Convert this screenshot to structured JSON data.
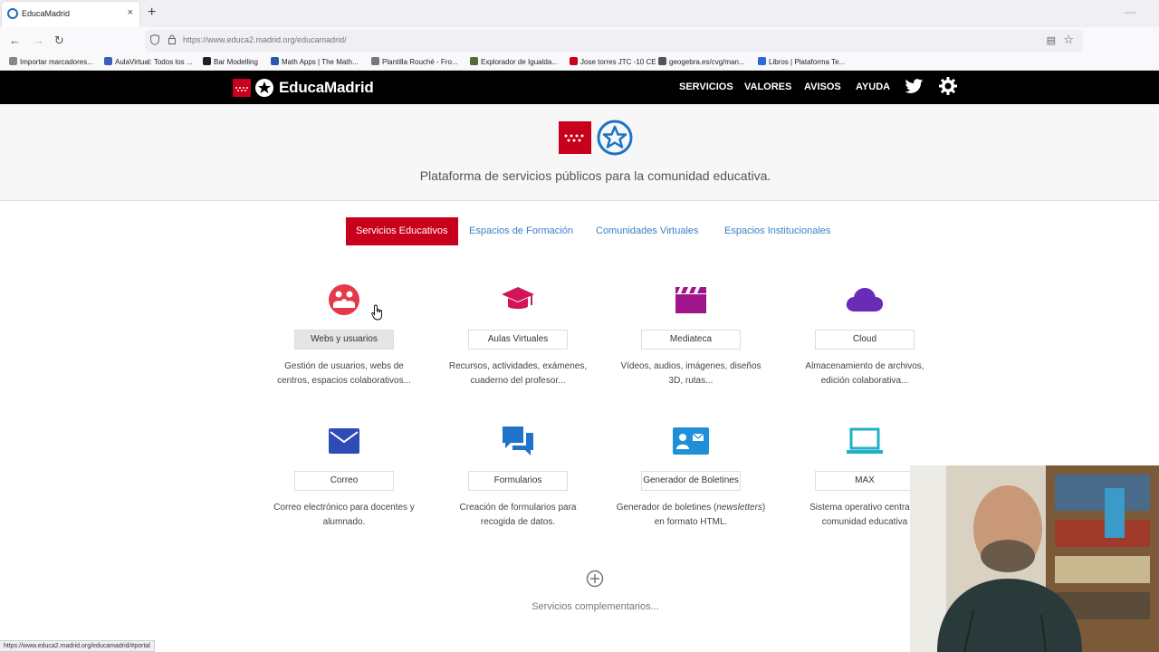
{
  "browser": {
    "tab_title": "EducaMadrid",
    "tab_close": "×",
    "new_tab": "+",
    "minimize": "—",
    "url": "https://www.educa2.madrid.org/educamadrid/",
    "bookmarks": [
      {
        "label": "Importar marcadores...",
        "color": "#888888"
      },
      {
        "label": "AulaVirtual: Todos los ...",
        "color": "#3a5fc0"
      },
      {
        "label": "Bar Modelling",
        "color": "#222222"
      },
      {
        "label": "Math Apps | The Math...",
        "color": "#2b5aa8"
      },
      {
        "label": "Plantilla Rouché - Fro...",
        "color": "#777777"
      },
      {
        "label": "Explorador de Igualda...",
        "color": "#556b2f"
      },
      {
        "label": "Jose torres JTC -10 CE",
        "color": "#c8001b"
      },
      {
        "label": "geogebra.es/cvg/man...",
        "color": "#555555"
      },
      {
        "label": "Libros | Plataforma Te...",
        "color": "#2b6bd8"
      }
    ],
    "status_url": "https://www.educa2.madrid.org/educamadrid/#portal"
  },
  "header": {
    "logo_text": "EducaMadrid",
    "menu": [
      "SERVICIOS",
      "VALORES",
      "AVISOS",
      "AYUDA"
    ]
  },
  "hero": {
    "tagline": "Plataforma de servicios públicos para la comunidad educativa."
  },
  "tabs": [
    {
      "label": "Servicios Educativos",
      "active": true
    },
    {
      "label": "Espacios de Formación",
      "active": false
    },
    {
      "label": "Comunidades Virtuales",
      "active": false
    },
    {
      "label": "Espacios Institucionales",
      "active": false
    }
  ],
  "services": [
    {
      "name": "Webs y usuarios",
      "desc1": "Gestión de usuarios, webs de",
      "desc2": "centros, espacios colaborativos...",
      "icon": "users-circle-icon",
      "color": "#e5384a"
    },
    {
      "name": "Aulas Virtuales",
      "desc1": "Recursos, actividades, exámenes,",
      "desc2": "cuaderno del profesor...",
      "icon": "graduation-cap-icon",
      "color": "#d4145a"
    },
    {
      "name": "Mediateca",
      "desc1": "Vídeos, audios, imágenes, diseños",
      "desc2": "3D, rutas...",
      "icon": "clapperboard-icon",
      "color": "#a0158c"
    },
    {
      "name": "Cloud",
      "desc1": "Almacenamiento de archivos,",
      "desc2": "edición colaborativa...",
      "icon": "cloud-icon",
      "color": "#6a2bb8"
    },
    {
      "name": "Correo",
      "desc1": "Correo electrónico para docentes y",
      "desc2": "alumnado.",
      "icon": "envelope-icon",
      "color": "#2f4bb5"
    },
    {
      "name": "Formularios",
      "desc1": "Creación de formularios para",
      "desc2": "recogida de datos.",
      "icon": "chat-bubbles-icon",
      "color": "#1f73c9"
    },
    {
      "name": "Generador de Boletines",
      "desc1": "Generador de boletines (",
      "desc_em": "newsletters",
      "desc1b": ")",
      "desc2": "en formato HTML.",
      "icon": "contact-card-icon",
      "color": "#1f8fd8"
    },
    {
      "name": "MAX",
      "desc1": "Sistema operativo centrado",
      "desc2": "comunidad educativa",
      "icon": "laptop-icon",
      "color": "#1fb0c8"
    }
  ],
  "more": {
    "label": "Servicios complementarios..."
  },
  "colors": {
    "brand_red": "#c8001b",
    "tab_link": "#3a7fc8"
  }
}
